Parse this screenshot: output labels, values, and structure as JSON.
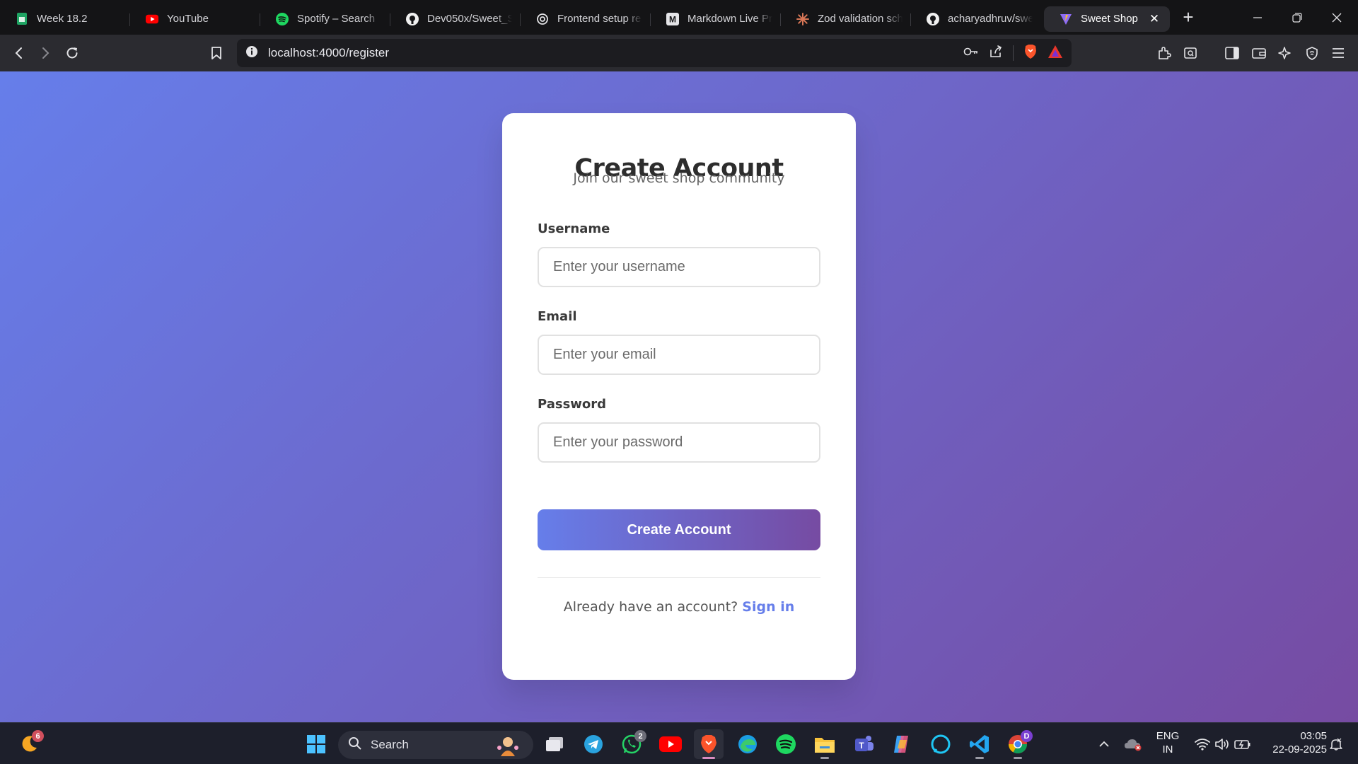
{
  "browser": {
    "tabs": [
      {
        "title": "Week 18.2",
        "icon": "sheets-icon"
      },
      {
        "title": "YouTube",
        "icon": "youtube-icon"
      },
      {
        "title": "Spotify – Search",
        "icon": "spotify-icon"
      },
      {
        "title": "Dev050x/Sweet_Sh",
        "icon": "github-icon"
      },
      {
        "title": "Frontend setup re",
        "icon": "openai-icon"
      },
      {
        "title": "Markdown Live Pr",
        "icon": "markdown-icon"
      },
      {
        "title": "Zod validation sch",
        "icon": "claude-icon"
      },
      {
        "title": "acharyadhruv/swe",
        "icon": "github-icon"
      },
      {
        "title": "Sweet Shop",
        "icon": "vite-icon",
        "active": true
      }
    ],
    "url": "localhost:4000/register"
  },
  "form": {
    "title": "Create Account",
    "subtitle": "Join our sweet shop community",
    "username_label": "Username",
    "username_placeholder": "Enter your username",
    "email_label": "Email",
    "email_placeholder": "Enter your email",
    "password_label": "Password",
    "password_placeholder": "Enter your password",
    "submit_label": "Create Account",
    "switch_text": "Already have an account?",
    "switch_link": "Sign in"
  },
  "taskbar": {
    "search_label": "Search",
    "widget_badge": "6",
    "whatsapp_badge": "2",
    "chrome_badge": "D",
    "language_line1": "ENG",
    "language_line2": "IN",
    "time": "03:05",
    "date": "22-09-2025"
  },
  "colors": {
    "gradient_start": "#667eea",
    "gradient_end": "#764ba2",
    "accent": "#667eea"
  }
}
